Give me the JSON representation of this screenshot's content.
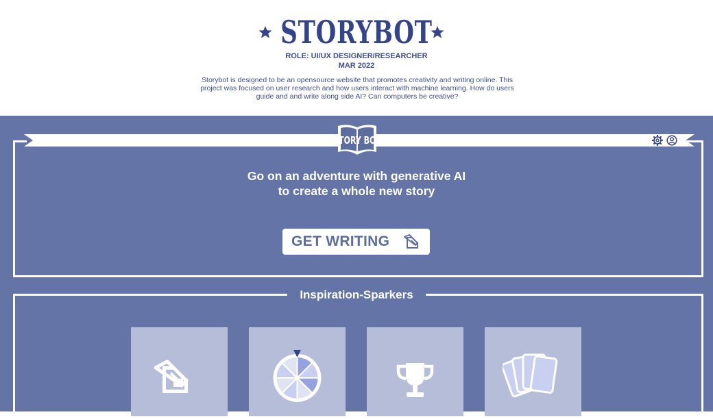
{
  "header": {
    "title": "STORYBOT",
    "role": "ROLE: UI/UX DESIGNER/RESEARCHER",
    "date": "MAR 2022",
    "description": "Storybot is designed to be an opensource website that promotes creativity and writing online. This project was focused on user research and how users interact with machine learning. How do users guide and and write along side AI? Can computers be creative?"
  },
  "app": {
    "logo_text": "STORY BOT",
    "headline": "Go on an adventure with generative AI to create a whole new story",
    "cta_label": "GET WRITING",
    "inspiration_title": "Inspiration-Sparkers",
    "cards": [
      {
        "icon": "writing-icon"
      },
      {
        "icon": "spinner-wheel-icon"
      },
      {
        "icon": "trophy-icon"
      },
      {
        "icon": "cards-icon"
      }
    ]
  },
  "colors": {
    "accent": "#6574a7",
    "title": "#34448a",
    "card": "#b5bdd8"
  }
}
